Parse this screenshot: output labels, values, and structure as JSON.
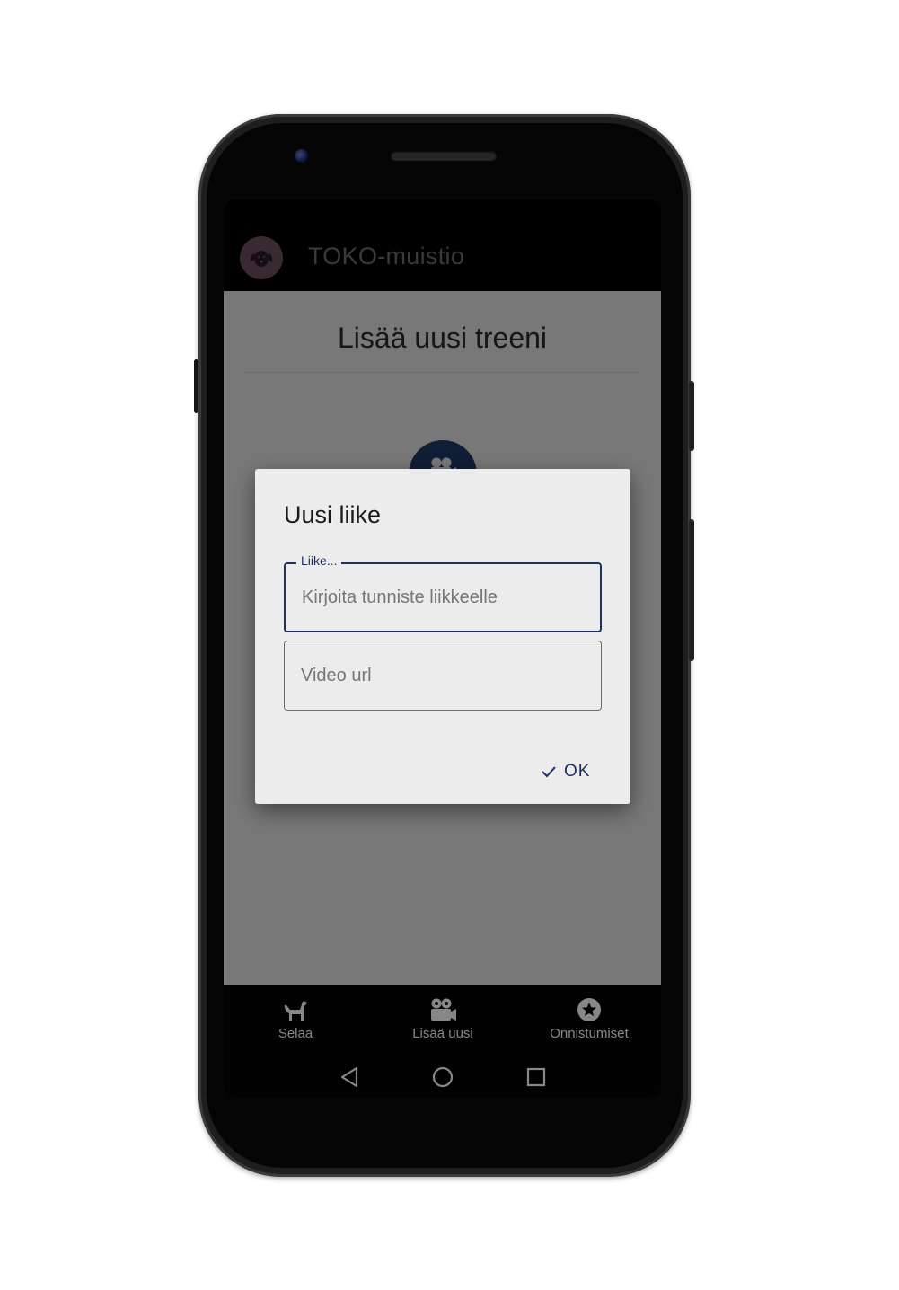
{
  "app": {
    "title": "TOKO-muistio"
  },
  "page": {
    "title": "Lisää uusi treeni"
  },
  "dialog": {
    "title": "Uusi liike",
    "movement_field": {
      "label": "Liike...",
      "placeholder": "Kirjoita tunniste liikkeelle",
      "value": ""
    },
    "video_field": {
      "placeholder": "Video url",
      "value": ""
    },
    "ok_label": "OK"
  },
  "bottom_nav": {
    "items": [
      {
        "label": "Selaa",
        "icon": "dog-icon",
        "active": false
      },
      {
        "label": "Lisää uusi",
        "icon": "video-camera-icon",
        "active": true
      },
      {
        "label": "Onnistumiset",
        "icon": "star-badge-icon",
        "active": false
      }
    ]
  },
  "system_nav": {
    "icons": [
      "back-icon",
      "home-icon",
      "recents-icon"
    ]
  },
  "colors": {
    "accent": "#1e3163",
    "logo_bg": "#6c4f5b",
    "dialog_bg": "#ececec",
    "content_bg": "#e2e2e2"
  }
}
